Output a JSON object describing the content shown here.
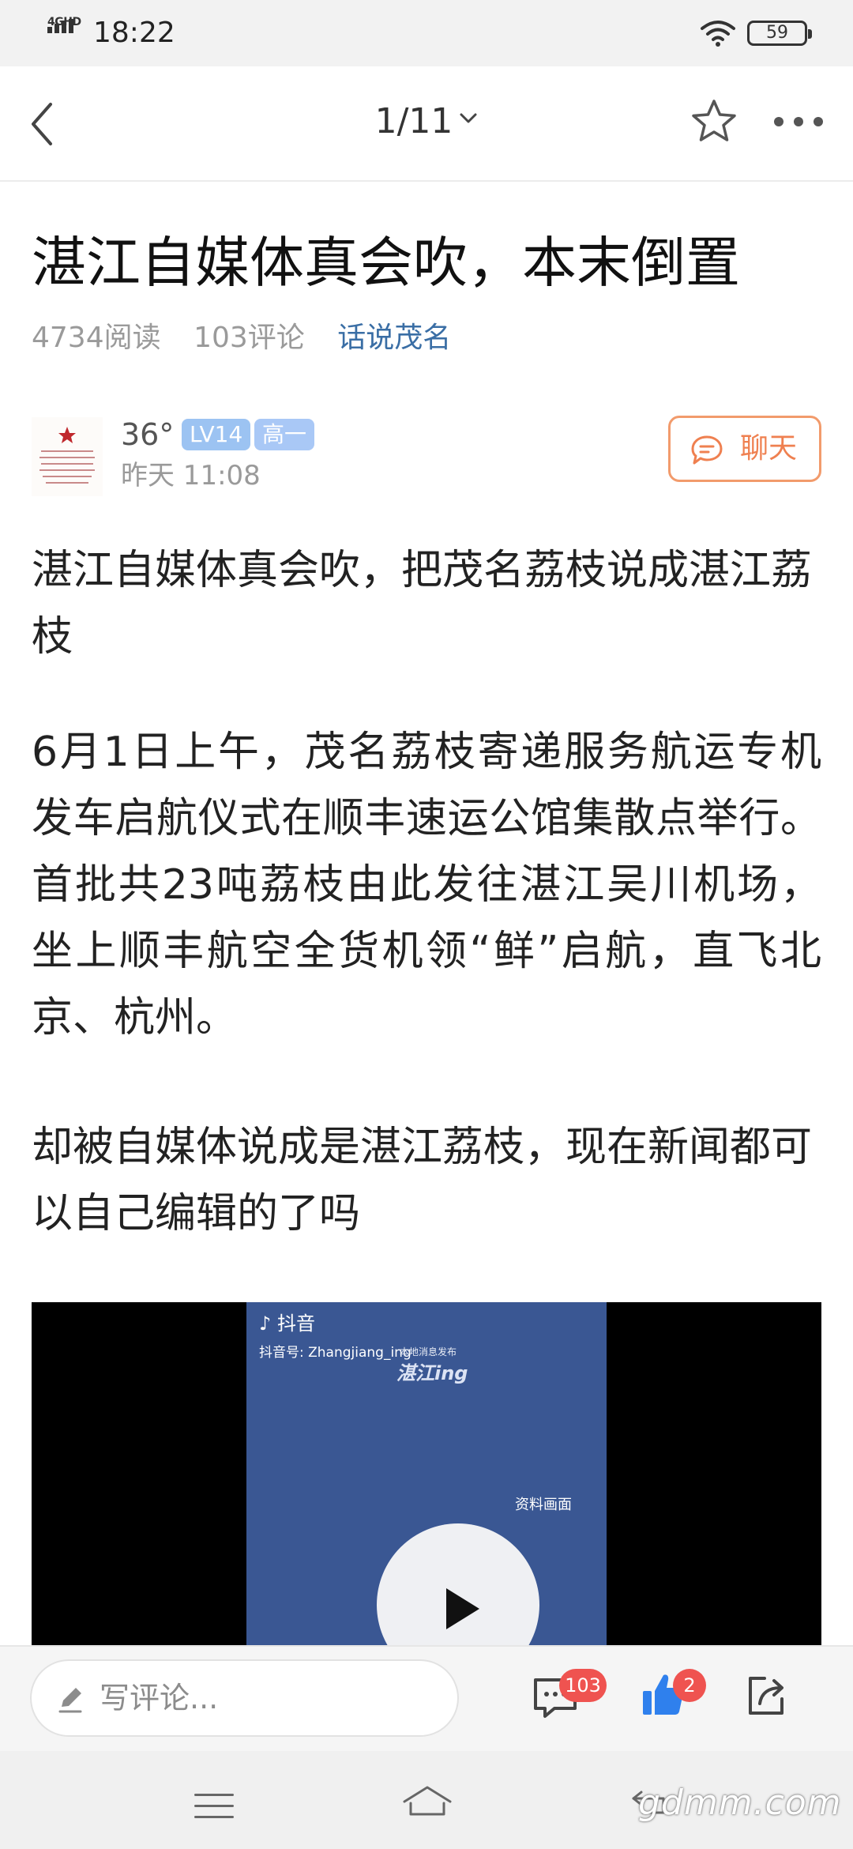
{
  "status_bar": {
    "network": "4GHD",
    "time": "18:22",
    "battery": "59"
  },
  "nav": {
    "page_counter": "1/11"
  },
  "article": {
    "title": "湛江自媒体真会吹，本末倒置",
    "reads": "4734阅读",
    "comments": "103评论",
    "topic": "话说茂名",
    "author": {
      "name": "36°",
      "level": "LV14",
      "grade": "高一",
      "time": "昨天 11:08",
      "chat_label": "聊天"
    },
    "paragraphs": [
      "湛江自媒体真会吹，把茂名荔枝说成湛江荔枝",
      "6月1日上午，茂名荔枝寄递服务航运专机发车启航仪式在顺丰速运公馆集散点举行。首批共23吨荔枝由此发往湛江吴川机场，坐上顺丰航空全货机领“鲜”启航，直飞北京、杭州。",
      "却被自媒体说成是湛江荔枝，现在新闻都可以自己编辑的了吗"
    ],
    "video": {
      "platform": "抖音",
      "account": "抖音号: Zhangjiang_ing",
      "watermark_sub": "本地消息发布",
      "watermark": "湛江ing",
      "caption": "资料画面"
    }
  },
  "bottom_bar": {
    "comment_placeholder": "写评论...",
    "comment_count": "103",
    "like_count": "2"
  },
  "watermark": "gdmm.com",
  "colors": {
    "link": "#3a6ea5",
    "chat_accent": "#ef8050",
    "like_blue": "#2f80ed",
    "badge_red": "#ef5350",
    "video_bg": "#3a5793"
  },
  "icons": [
    "back-icon",
    "chevron-down-icon",
    "star-icon",
    "more-icon",
    "chat-icon",
    "play-icon",
    "pen-icon",
    "comments-icon",
    "like-icon",
    "share-icon",
    "menu-icon",
    "home-icon",
    "back-nav-icon"
  ]
}
